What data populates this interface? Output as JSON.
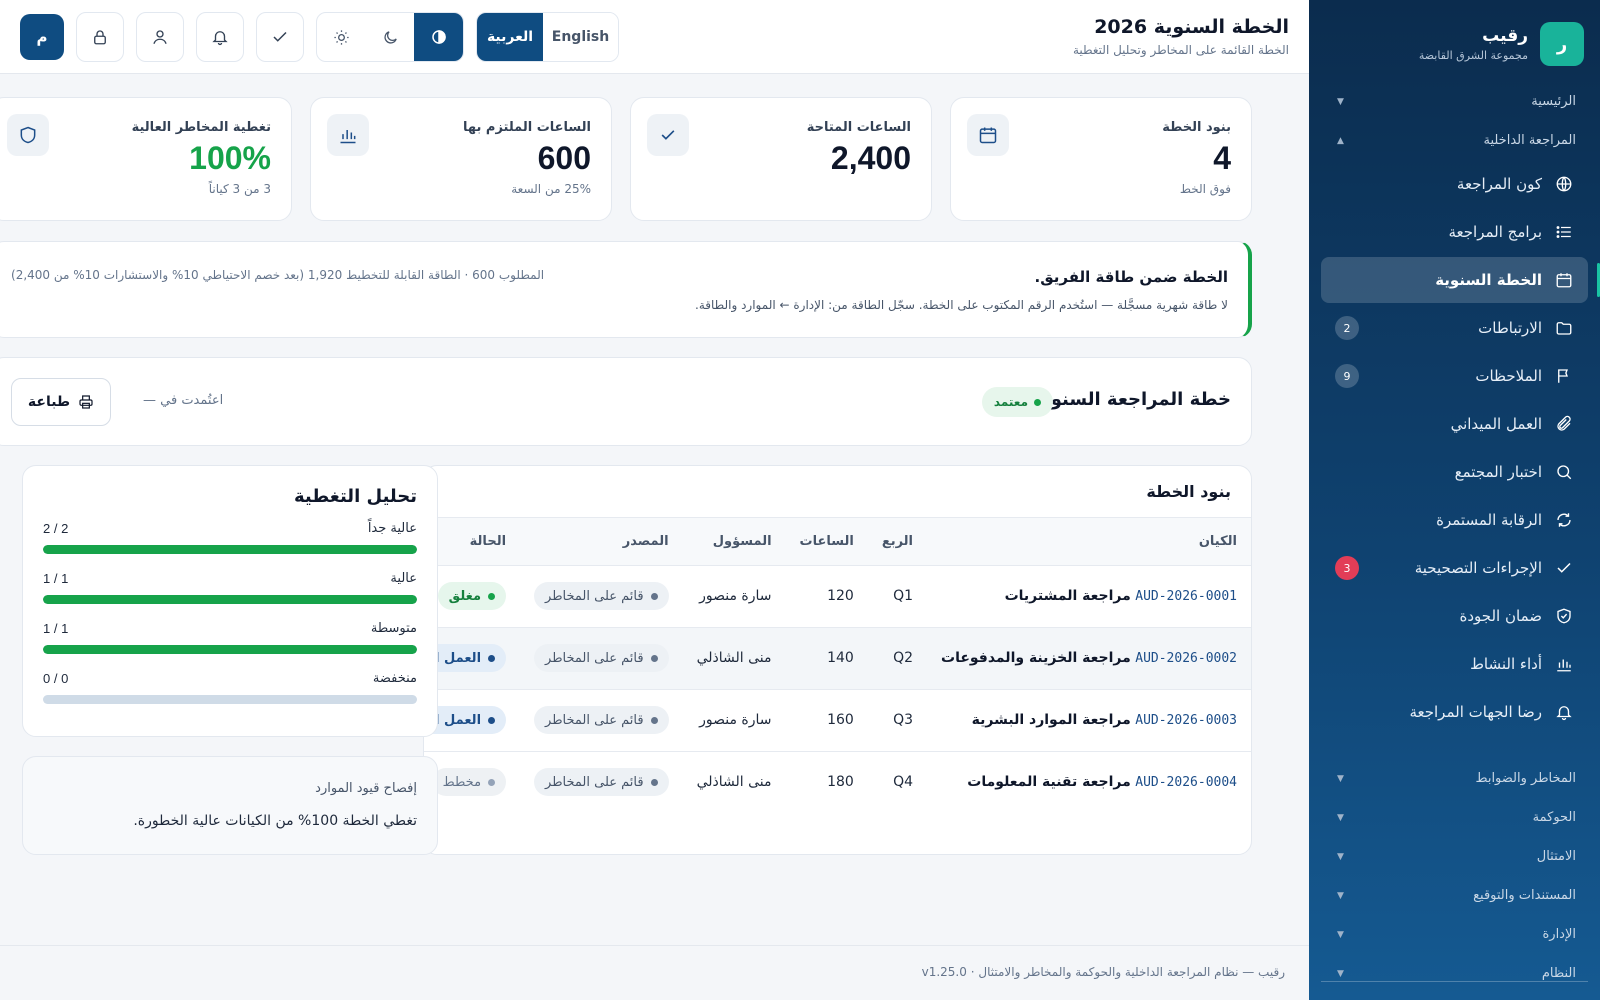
{
  "brand": {
    "logo_letter": "ر",
    "name": "رقيب",
    "org": "مجموعة الشرق القابضة"
  },
  "sidebar": {
    "groups_top": [
      {
        "label": "الرئيسية",
        "expanded": false
      },
      {
        "label": "المراجعة الداخلية",
        "expanded": true
      }
    ],
    "items": [
      {
        "label": "كون المراجعة",
        "icon": "globe-icon",
        "badge": ""
      },
      {
        "label": "برامج المراجعة",
        "icon": "list-icon",
        "badge": ""
      },
      {
        "label": "الخطة السنوية",
        "icon": "calendar-icon",
        "badge": "",
        "active": true
      },
      {
        "label": "الارتباطات",
        "icon": "folder-icon",
        "badge": "2"
      },
      {
        "label": "الملاحظات",
        "icon": "flag-icon",
        "badge": "9"
      },
      {
        "label": "العمل الميداني",
        "icon": "paperclip-icon",
        "badge": ""
      },
      {
        "label": "اختبار المجتمع",
        "icon": "search-icon",
        "badge": ""
      },
      {
        "label": "الرقابة المستمرة",
        "icon": "refresh-icon",
        "badge": ""
      },
      {
        "label": "الإجراءات التصحيحية",
        "icon": "check-icon",
        "badge": "3"
      },
      {
        "label": "ضمان الجودة",
        "icon": "shield-check-icon",
        "badge": ""
      },
      {
        "label": "أداء النشاط",
        "icon": "bar-chart-icon",
        "badge": ""
      },
      {
        "label": "رضا الجهات المراجعة",
        "icon": "bell-icon",
        "badge": ""
      }
    ],
    "groups_bottom": [
      "المخاطر والضوابط",
      "الحوكمة",
      "الامتثال",
      "المستندات والتوقيع",
      "الإدارة",
      "النظام"
    ]
  },
  "header": {
    "title": "الخطة السنوية 2026",
    "subtitle": "الخطة القائمة على المخاطر وتحليل التغطية",
    "lang_ar": "العربية",
    "lang_en": "English",
    "avatar_letter": "م"
  },
  "stats": [
    {
      "label": "بنود الخطة",
      "value": "4",
      "sub": "فوق الخط",
      "icon": "calendar-icon"
    },
    {
      "label": "الساعات المتاحة",
      "value": "2,400",
      "sub": "",
      "icon": "check-icon"
    },
    {
      "label": "الساعات الملتزم بها",
      "value": "600",
      "sub": "25% من السعة",
      "icon": "bar-chart-icon"
    },
    {
      "label": "تغطية المخاطر العالية",
      "value": "100%",
      "sub": "3 من 3 كياناً",
      "icon": "shield-icon"
    }
  ],
  "alert": {
    "title": "الخطة ضمن طاقة الفريق.",
    "body": "لا طاقة شهرية مسجَّلة — استُخدم الرقم المكتوب على الخطة. سجّل الطاقة من: الإدارة ← الموارد والطاقة.",
    "meta": "المطلوب 600 · الطاقة القابلة للتخطيط 1,920 (بعد خصم الاحتياطي 10% والاستشارات 10% من 2,400)",
    "accent": "#16a34a"
  },
  "plan": {
    "title": "خطة المراجعة السنوية",
    "status": "معتمد",
    "approved_in": "اعتُمدت في —",
    "print_label": "طباعة"
  },
  "table": {
    "title": "بنود الخطة",
    "columns": [
      "الكيان",
      "الربع",
      "الساعات",
      "المسؤول",
      "المصدر",
      "الحالة"
    ],
    "rows": [
      {
        "code": "AUD-2026-0001",
        "entity": "مراجعة المشتريات",
        "quarter": "Q1",
        "hours": "120",
        "owner": "سارة منصور",
        "source": "قائم على المخاطر",
        "status": "مغلق",
        "status_kind": "closed"
      },
      {
        "code": "AUD-2026-0002",
        "entity": "مراجعة الخزينة والمدفوعات",
        "quarter": "Q2",
        "hours": "140",
        "owner": "منى الشاذلي",
        "source": "قائم على المخاطر",
        "status": "العمل الميداني",
        "status_kind": "field"
      },
      {
        "code": "AUD-2026-0003",
        "entity": "مراجعة الموارد البشرية",
        "quarter": "Q3",
        "hours": "160",
        "owner": "سارة منصور",
        "source": "قائم على المخاطر",
        "status": "العمل الميداني",
        "status_kind": "field"
      },
      {
        "code": "AUD-2026-0004",
        "entity": "مراجعة تقنية المعلومات",
        "quarter": "Q4",
        "hours": "180",
        "owner": "منى الشاذلي",
        "source": "قائم على المخاطر",
        "status": "مخطط",
        "status_kind": "planned"
      }
    ]
  },
  "coverage": {
    "title": "تحليل التغطية",
    "rows": [
      {
        "label": "عالية جداً",
        "text": "2 / 2",
        "fraction": 1
      },
      {
        "label": "عالية",
        "text": "1 / 1",
        "fraction": 1
      },
      {
        "label": "متوسطة",
        "text": "1 / 1",
        "fraction": 1
      },
      {
        "label": "منخفضة",
        "text": "0 / 0",
        "fraction": 0
      }
    ]
  },
  "disclosure": {
    "title": "إفصاح قيود الموارد",
    "body": "تغطي الخطة 100% من الكيانات عالية الخطورة."
  },
  "footer": {
    "text": "رقيب — نظام المراجعة الداخلية والحوكمة والمخاطر والامتثال",
    "version": "v1.25.0"
  },
  "colors": {
    "primary": "#0f4c81",
    "sidebar": "#0b2c4e",
    "success": "#16a34a",
    "danger": "#e23d57",
    "brand_teal": "#19b39a"
  }
}
